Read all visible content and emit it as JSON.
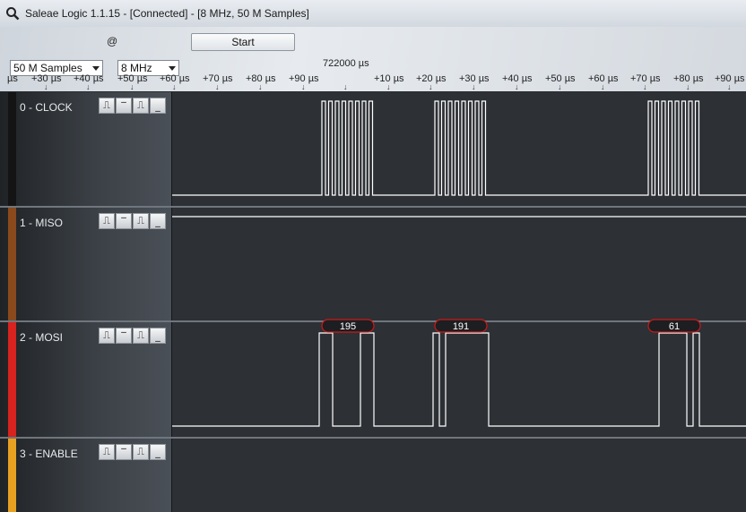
{
  "window": {
    "title": "Saleae Logic 1.1.15 - [Connected] - [8 MHz, 50 M Samples]"
  },
  "toolbar": {
    "samples_select": "50 M Samples",
    "at_sign": "@",
    "rate_select": "8 MHz",
    "start_label": "Start"
  },
  "ruler": {
    "marker_time": "722000 µs",
    "labels": [
      "µs",
      "+30 µs",
      "+40 µs",
      "+50 µs",
      "+60 µs",
      "+70 µs",
      "+80 µs",
      "+90 µs",
      "+10 µs",
      "+20 µs",
      "+30 µs",
      "+40 µs",
      "+50 µs",
      "+60 µs",
      "+70 µs",
      "+80 µs",
      "+90 µs"
    ]
  },
  "channels": [
    {
      "label": "0 - CLOCK",
      "color": "#141414"
    },
    {
      "label": "1 - MISO",
      "color": "#8a4a1c"
    },
    {
      "label": "2 - MOSI",
      "color": "#d8231e"
    },
    {
      "label": "3 - ENABLE",
      "color": "#e8a021"
    }
  ],
  "decoded": {
    "mosi_values": [
      "195",
      "191",
      "61"
    ]
  },
  "colors": {
    "trace": "#ffffff",
    "decode_border": "#cc1818",
    "plot_bg": "#2d3035"
  },
  "icons": {
    "app": "magnifier-icon",
    "trigger_buttons": [
      "rising-edge-icon",
      "high-level-icon",
      "falling-edge-icon",
      "low-level-icon"
    ]
  }
}
